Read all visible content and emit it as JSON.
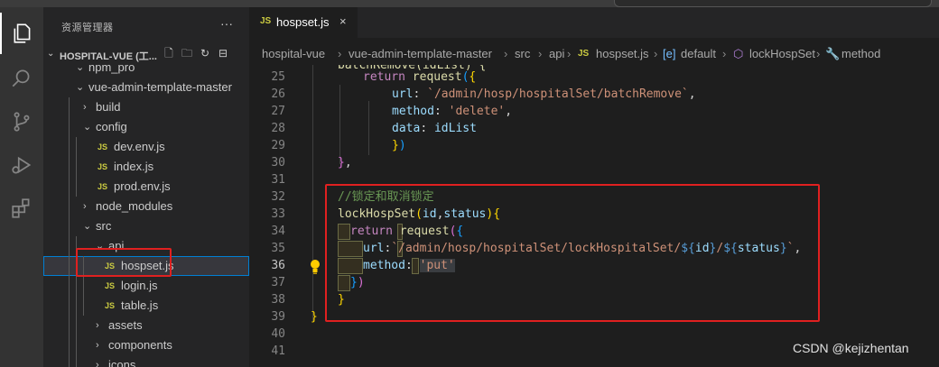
{
  "sidebar": {
    "title": "资源管理器",
    "more": "···",
    "project": "HOSPITAL-VUE (工...",
    "tree": [
      {
        "label": "npm_pro",
        "kind": "folder-open",
        "depth": 1
      },
      {
        "label": "vue-admin-template-master",
        "kind": "folder-open",
        "depth": 1
      },
      {
        "label": "build",
        "kind": "folder",
        "depth": 2
      },
      {
        "label": "config",
        "kind": "folder-open",
        "depth": 2
      },
      {
        "label": "dev.env.js",
        "kind": "file",
        "depth": 3
      },
      {
        "label": "index.js",
        "kind": "file",
        "depth": 3
      },
      {
        "label": "prod.env.js",
        "kind": "file",
        "depth": 3
      },
      {
        "label": "node_modules",
        "kind": "folder",
        "depth": 2
      },
      {
        "label": "src",
        "kind": "folder-open",
        "depth": 2
      },
      {
        "label": "api",
        "kind": "folder-open",
        "depth": 3
      },
      {
        "label": "hospset.js",
        "kind": "file",
        "depth": 4,
        "selected": true
      },
      {
        "label": "login.js",
        "kind": "file",
        "depth": 4
      },
      {
        "label": "table.js",
        "kind": "file",
        "depth": 4
      },
      {
        "label": "assets",
        "kind": "folder",
        "depth": 3
      },
      {
        "label": "components",
        "kind": "folder",
        "depth": 3
      },
      {
        "label": "icons",
        "kind": "folder",
        "depth": 3
      }
    ],
    "js_badge": "JS"
  },
  "editor": {
    "tab": {
      "badge": "JS",
      "label": "hospset.js",
      "close": "×"
    },
    "breadcrumb": [
      "hospital-vue",
      "vue-admin-template-master",
      "src",
      "api",
      "hospset.js",
      "default",
      "lockHospSet",
      "method"
    ]
  },
  "code": {
    "line_numbers": [
      "25",
      "26",
      "27",
      "28",
      "29",
      "30",
      "31",
      "32",
      "33",
      "34",
      "35",
      "36",
      "37",
      "38",
      "39",
      "40",
      "41"
    ],
    "current_line": "36",
    "comment": "//锁定和取消锁定",
    "lines": {
      "l24": "batchRemove(idList) {",
      "l25_kw": "return",
      "l25_fn": "request",
      "l26_prop": "url",
      "l26_str": "`/admin/hosp/hospitalSet/batchRemove`",
      "l27_prop": "method",
      "l27_str": "'delete'",
      "l28_prop": "data",
      "l28_val": "idList",
      "l33_fn": "lockHospSet",
      "l33_p1": "id",
      "l33_p2": "status",
      "l34_kw": "return",
      "l34_fn": "request",
      "l35_prop": "url",
      "l35_str_a": "`/admin/hosp/hospitalSet/lockHospitalSet/",
      "l35_v1": "id",
      "l35_v2": "status",
      "l35_str_b": "`",
      "l36_prop": "method",
      "l36_str": "'put'"
    }
  },
  "watermark": "CSDN @kejizhentan",
  "colors": {
    "highlight_box": "#e02020",
    "selection_outline": "#007fd4"
  }
}
